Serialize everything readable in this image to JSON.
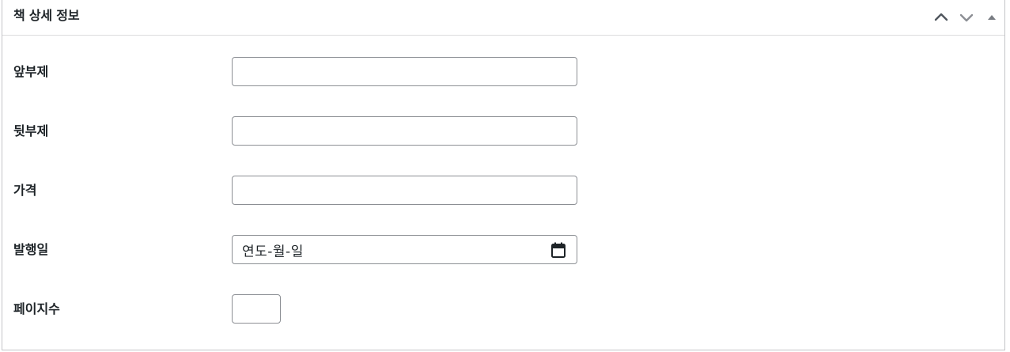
{
  "metabox": {
    "title": "책 상세 정보",
    "icons": {
      "move_up": "chevron-up-icon",
      "move_down": "chevron-down-icon",
      "toggle": "triangle-up-icon"
    }
  },
  "fields": {
    "front_subtitle": {
      "label": "앞부제",
      "value": ""
    },
    "back_subtitle": {
      "label": "뒷부제",
      "value": ""
    },
    "price": {
      "label": "가격",
      "value": ""
    },
    "publish_date": {
      "label": "발행일",
      "placeholder": "연도-월-일",
      "icon": "calendar-icon"
    },
    "page_count": {
      "label": "페이지수",
      "value": ""
    }
  },
  "colors": {
    "border": "#c3c4c7",
    "input_border": "#8c8f94",
    "text": "#1d2327",
    "icon": "#787c82"
  }
}
